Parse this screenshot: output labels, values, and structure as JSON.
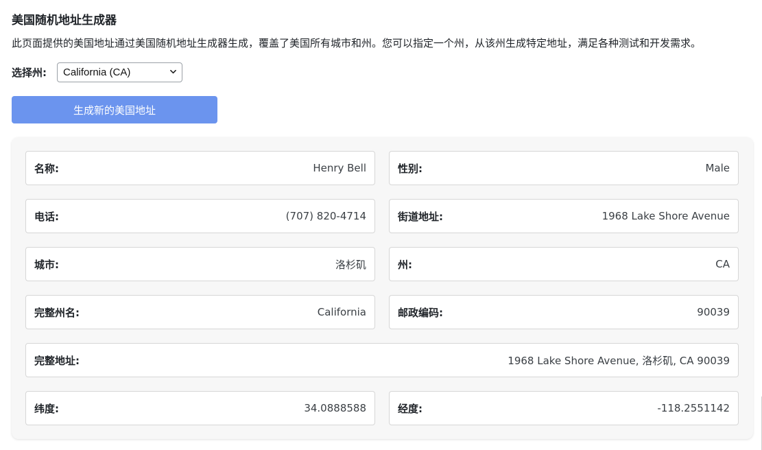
{
  "header": {
    "title": "美国随机地址生成器",
    "description": "此页面提供的美国地址通过美国随机地址生成器生成，覆盖了美国所有城市和州。您可以指定一个州，从该州生成特定地址，满足各种测试和开发需求。"
  },
  "state_selector": {
    "label": "选择州:",
    "selected": "California (CA)",
    "icon": "chevron-down-icon"
  },
  "generate_button": {
    "label": "生成新的美国地址",
    "color": "#6b94ee"
  },
  "fields": {
    "name": {
      "label": "名称:",
      "value": "Henry Bell"
    },
    "gender": {
      "label": "性别:",
      "value": "Male"
    },
    "phone": {
      "label": "电话:",
      "value": "(707) 820-4714"
    },
    "street": {
      "label": "街道地址:",
      "value": "1968 Lake Shore Avenue"
    },
    "city": {
      "label": "城市:",
      "value": "洛杉矶"
    },
    "state": {
      "label": "州:",
      "value": "CA"
    },
    "state_full": {
      "label": "完整州名:",
      "value": "California"
    },
    "zip": {
      "label": "邮政编码:",
      "value": "90039"
    },
    "full_address": {
      "label": "完整地址:",
      "value": "1968 Lake Shore Avenue, 洛杉矶, CA 90039"
    },
    "latitude": {
      "label": "纬度:",
      "value": "34.0888588"
    },
    "longitude": {
      "label": "经度:",
      "value": "-118.2551142"
    }
  }
}
